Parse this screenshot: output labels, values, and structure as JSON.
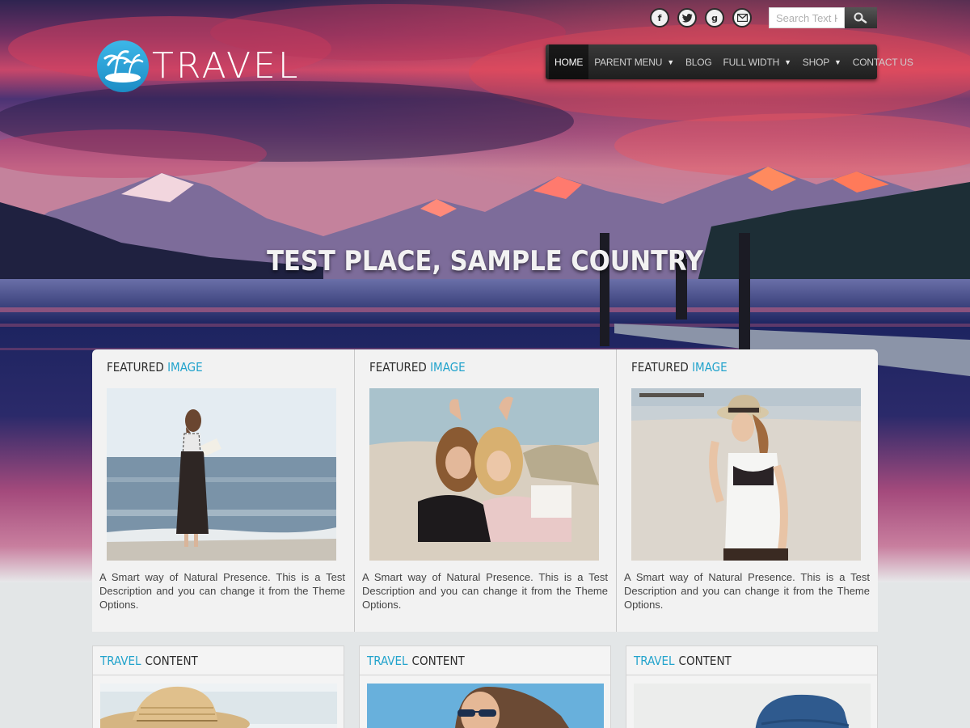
{
  "header": {
    "logo_text": "TRAVEL",
    "search_placeholder": "Search Text H",
    "social": [
      {
        "icon": "facebook-icon",
        "glyph": "f"
      },
      {
        "icon": "twitter-icon",
        "glyph": "t"
      },
      {
        "icon": "google-plus-icon",
        "glyph": "g"
      },
      {
        "icon": "email-icon",
        "glyph": "✉"
      }
    ]
  },
  "nav": {
    "items": [
      {
        "label": "HOME",
        "active": true,
        "dropdown": false
      },
      {
        "label": "PARENT MENU",
        "active": false,
        "dropdown": true
      },
      {
        "label": "BLOG",
        "active": false,
        "dropdown": false
      },
      {
        "label": "FULL WIDTH",
        "active": false,
        "dropdown": true
      },
      {
        "label": "SHOP",
        "active": false,
        "dropdown": true
      },
      {
        "label": "CONTACT US",
        "active": false,
        "dropdown": false
      }
    ]
  },
  "hero": {
    "title": "TEST PLACE, SAMPLE COUNTRY"
  },
  "featured": {
    "items": [
      {
        "head_main": "FEATURED",
        "head_accent": "IMAGE",
        "image": "woman-reading-on-beach",
        "description": "A Smart way of Natural Presence. This is a Test Description and you can change it from the Theme Options."
      },
      {
        "head_main": "FEATURED",
        "head_accent": "IMAGE",
        "image": "two-women-lying-on-sand",
        "description": "A Smart way of Natural Presence. This is a Test Description and you can change it from the Theme Options."
      },
      {
        "head_main": "FEATURED",
        "head_accent": "IMAGE",
        "image": "woman-with-hat-on-beach",
        "description": "A Smart way of Natural Presence. This is a Test Description and you can change it from the Theme Options."
      }
    ]
  },
  "travel_content": {
    "items": [
      {
        "head_accent": "TRAVEL",
        "head_main": "CONTENT",
        "image": "straw-hat"
      },
      {
        "head_accent": "TRAVEL",
        "head_main": "CONTENT",
        "image": "woman-sunglasses"
      },
      {
        "head_accent": "TRAVEL",
        "head_main": "CONTENT",
        "image": "blue-hat"
      }
    ]
  },
  "colors": {
    "accent": "#22a3cc",
    "nav_bg": "#262626",
    "panel_bg": "#f2f2f2",
    "page_bg": "#e3e6e7"
  }
}
